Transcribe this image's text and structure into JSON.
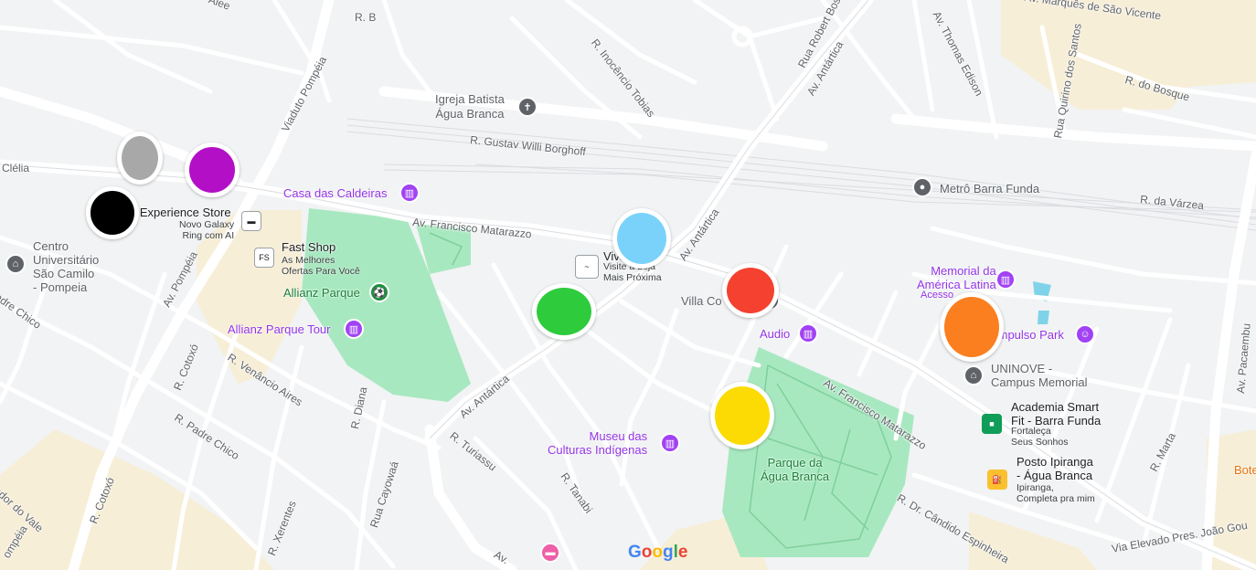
{
  "roads": {
    "r_b": "R. B",
    "marques": "Av. Marquês de São Vicente",
    "inocencio": "R. Inocêncio Tobias",
    "robert_bosch": "Rua Robert Bosch",
    "antartica_top": "Av. Antártica",
    "thomas_edison": "Av. Thomas Edison",
    "quirino": "Rua Quirino dos Santos",
    "do_bosque": "R. do Bosque",
    "viaduto": "Viaduto Pompéia",
    "gustav": "R. Gustav Willi Borghoff",
    "clelia": "Clélia",
    "varzea": "R. da Várzea",
    "matarazzo1": "Av. Francisco Matarazzo",
    "antartica_mid": "Av. Antártica",
    "pompeia": "Av. Pompéia",
    "padre_chico_left": "adre Chico",
    "cotoxo1": "R. Cotoxó",
    "venancio": "R. Venâncio Aires",
    "diana": "R. Diana",
    "padre_chico": "R. Padre Chico",
    "antartica_low": "Av. Antártica",
    "turiassu": "R. Turiassu",
    "tanabi": "R. Tanabi",
    "cayowaa": "Rua Cayowaá",
    "xerentes": "R. Xerentes",
    "cotoxo2": "R. Cotoxó",
    "vale": "ador do Vale",
    "pompeia_bottom": "ompéia",
    "matarazzo2": "Av. Francisco Matarazzo",
    "candido": "R. Dr. Cândido Espinheira",
    "elevado": "Via Elevado Pres. João Gou",
    "pacaembu": "Av. Pacaembu",
    "marta": "R. Marta",
    "av_bottom": "Av.",
    "top_partial": "Alee"
  },
  "pois": {
    "igreja": "Igreja Batista\nÁgua Branca",
    "casa_caldeiras": "Casa das Caldeiras",
    "metro": "Metrô Barra Funda",
    "experience_store": "g Experience Store",
    "experience_sub": "Novo Galaxy\nRing com AI",
    "centro": "Centro\nUniversitário\nSão Camilo\n- Pompeia",
    "fast_shop": "Fast Shop",
    "fast_shop_sub": "As Melhores\nOfertas Para Você",
    "allianz_parque": "Allianz Parque",
    "allianz_tour": "Allianz Parque Tour",
    "viva": "Viva",
    "viva_sub": "Visite a Loja\nMais Próxima",
    "villa": "Villa Co",
    "audio": "Audio",
    "memorial": "Memorial da\nAmérica Latina",
    "memorial_sub": "Acesso",
    "impulso": "Impulso Park",
    "uninove": "UNINOVE -\nCampus Memorial",
    "academia": "Academia Smart\nFit - Barra Funda",
    "academia_sub": "Fortaleça\nSeus Sonhos",
    "posto": "Posto Ipiranga\n- Água Branca",
    "posto_sub": "Ipiranga,\nCompleta pra mim",
    "museu": "Museu das\nCulturas Indígenas",
    "parque_agua": "Parque da\nÁgua Branca",
    "bote": "Bote"
  },
  "markers": [
    {
      "name": "gray-marker",
      "color": "#a8a8a8"
    },
    {
      "name": "purple-marker",
      "color": "#b30fc6"
    },
    {
      "name": "black-marker",
      "color": "#000000"
    },
    {
      "name": "light-blue-marker",
      "color": "#7ad2fb"
    },
    {
      "name": "green-marker",
      "color": "#2ecb3c"
    },
    {
      "name": "red-marker",
      "color": "#f5412f"
    },
    {
      "name": "orange-marker",
      "color": "#fb7f1f"
    },
    {
      "name": "yellow-marker",
      "color": "#fbdb03"
    }
  ],
  "brand": {
    "google": "Google"
  },
  "colors": {
    "park": "#a8e8c0",
    "built": "#f7eed7",
    "road": "#ffffff",
    "background": "#f1f3f4",
    "poi_purple": "#9334e6",
    "poi_gray": "#5f6368"
  }
}
